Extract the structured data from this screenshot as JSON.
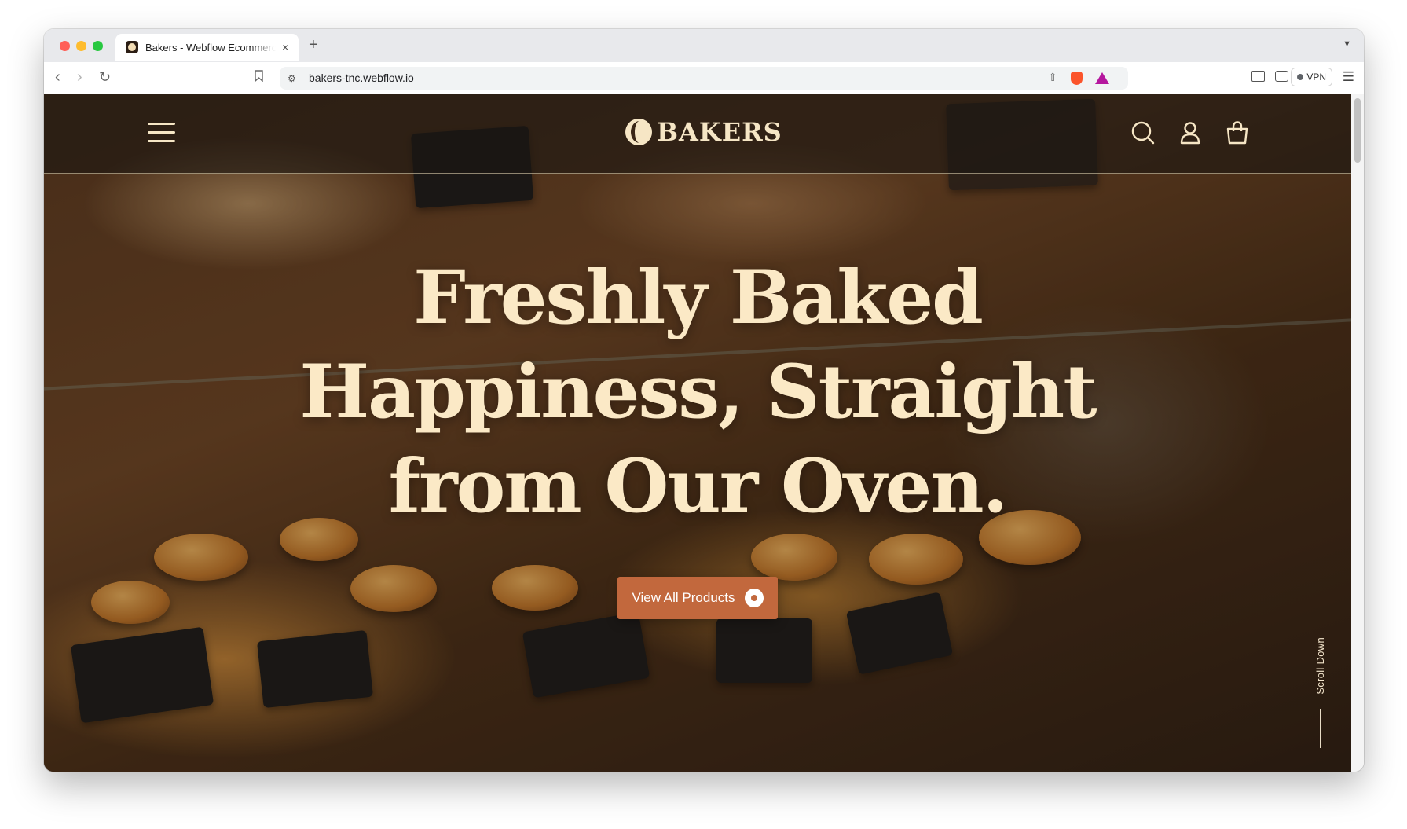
{
  "browser": {
    "tab_title": "Bakers - Webflow Ecommerce",
    "tab_close": "×",
    "new_tab": "+",
    "url": "bakers-tnc.webflow.io",
    "vpn_label": "VPN"
  },
  "site": {
    "logo_text": "BAKERS",
    "hero_title_line1": "Freshly Baked",
    "hero_title_line2": "Happiness, Straight",
    "hero_title_line3": "from Our Oven.",
    "cta_label": "View All Products",
    "scroll_label": "Scroll Down"
  },
  "colors": {
    "hero_text": "#fbe9c6",
    "cta_background": "#c2683d"
  }
}
